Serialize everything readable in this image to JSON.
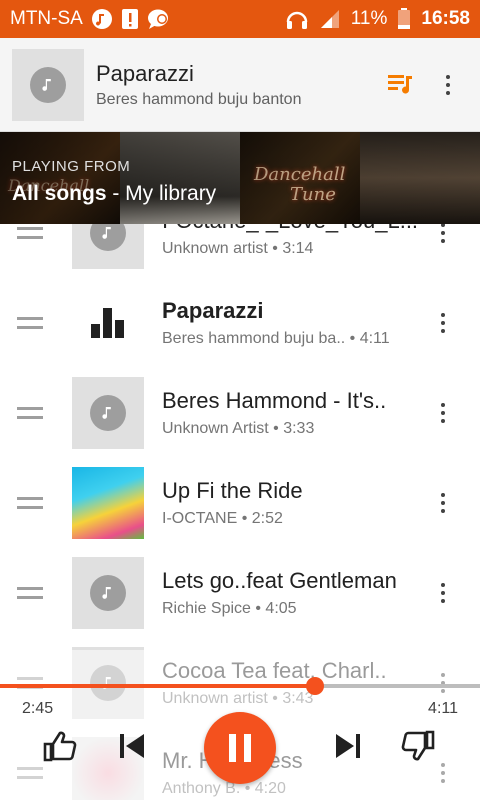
{
  "status_bar": {
    "carrier": "MTN-SA",
    "battery": "11%",
    "time": "16:58",
    "icons": [
      "music-note-icon",
      "alert-icon",
      "chat-icon",
      "headset-icon",
      "signal-icon",
      "battery-icon"
    ]
  },
  "now_playing": {
    "title": "Paparazzi",
    "artist": "Beres hammond buju banton",
    "queue_icon": "queue-music-icon",
    "more_icon": "more-vert-icon"
  },
  "banner": {
    "label": "PLAYING FROM",
    "source_bold": "All songs",
    "source_rest": " - My library"
  },
  "tracks": [
    {
      "title": "I-Octane_-_Love_You_L...",
      "subtitle": "Unknown artist • 3:14",
      "art": "placeholder"
    },
    {
      "title": "Paparazzi",
      "subtitle": "Beres hammond buju ba..  • 4:11",
      "art": "equalizer",
      "playing": true
    },
    {
      "title": "Beres Hammond - It's..",
      "subtitle": "Unknown Artist • 3:33",
      "art": "placeholder"
    },
    {
      "title": "Up Fi the Ride",
      "subtitle": "I-OCTANE • 2:52",
      "art": "tropical"
    },
    {
      "title": "Lets go..feat Gentleman",
      "subtitle": "Richie Spice • 4:05",
      "art": "placeholder"
    },
    {
      "title": "Cocoa Tea feat. Charl..",
      "subtitle": "Unknown artist • 3:43",
      "art": "placeholder"
    },
    {
      "title": "Mr. Happiness",
      "subtitle": "Anthony B. • 4:20",
      "art": "placeholder"
    }
  ],
  "player": {
    "elapsed": "2:45",
    "total": "4:11",
    "progress": 0.657,
    "accent": "#f4511e"
  }
}
